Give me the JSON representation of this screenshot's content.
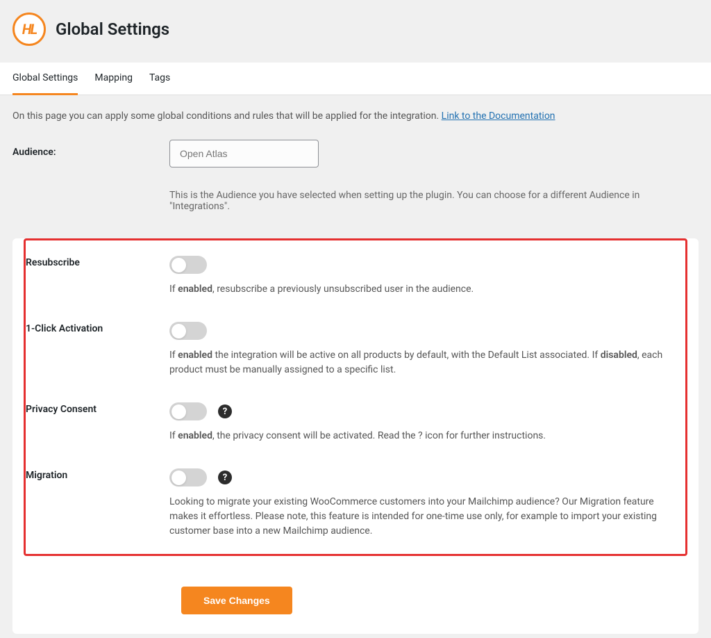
{
  "header": {
    "logo_text": "HL",
    "title": "Global Settings"
  },
  "tabs": [
    {
      "label": "Global Settings",
      "active": true
    },
    {
      "label": "Mapping",
      "active": false
    },
    {
      "label": "Tags",
      "active": false
    }
  ],
  "intro": {
    "text": "On this page you can apply some global conditions and rules that will be applied for the integration. ",
    "link_text": "Link to the Documentation"
  },
  "audience": {
    "label": "Audience:",
    "value": "Open Atlas",
    "help": "This is the Audience you have selected when setting up the plugin. You can choose for a different Audience in \"Integrations\"."
  },
  "settings": {
    "resubscribe": {
      "label": "Resubscribe",
      "desc_pre": "If ",
      "desc_bold1": "enabled",
      "desc_post": ", resubscribe a previously unsubscribed user in the audience."
    },
    "one_click": {
      "label": "1-Click Activation",
      "desc_pre": "If ",
      "desc_bold1": "enabled",
      "desc_mid": " the integration will be active on all products by default, with the Default List associated. If ",
      "desc_bold2": "disabled",
      "desc_post": ", each product must be manually assigned to a specific list."
    },
    "privacy": {
      "label": "Privacy Consent",
      "desc_pre": "If ",
      "desc_bold1": "enabled",
      "desc_post": ", the privacy consent will be activated. Read the ? icon for further instructions."
    },
    "migration": {
      "label": "Migration",
      "desc": "Looking to migrate your existing WooCommerce customers into your Mailchimp audience? Our Migration feature makes it effortless. Please note, this feature is intended for one-time use only, for example to import your existing customer base into a new Mailchimp audience."
    }
  },
  "save_button": "Save Changes",
  "help_glyph": "?"
}
